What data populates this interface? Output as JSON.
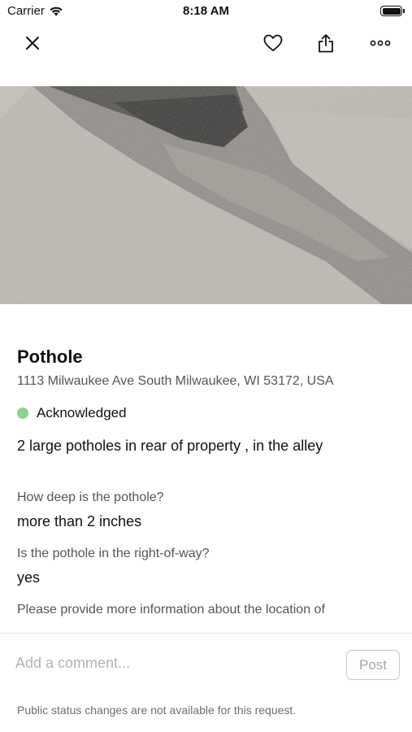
{
  "status_bar": {
    "carrier": "Carrier",
    "time": "8:18 AM"
  },
  "nav": {
    "icons": [
      "close-icon",
      "heart-icon",
      "share-icon",
      "more-icon"
    ]
  },
  "request": {
    "title": "Pothole",
    "address": "1113 Milwaukee Ave South Milwaukee, WI 53172, USA",
    "status": "Acknowledged",
    "status_color": "#8bd28f",
    "description": "2 large potholes in rear of property , in the alley",
    "questions": [
      {
        "question": "How deep is the pothole?",
        "answer": "more than 2 inches"
      },
      {
        "question": "Is the pothole in the right-of-way?",
        "answer": "yes"
      },
      {
        "question": "Please provide more information about the location of"
      }
    ]
  },
  "comment": {
    "placeholder": "Add a comment...",
    "post_label": "Post",
    "footnote": "Public status changes are not available for this request."
  }
}
